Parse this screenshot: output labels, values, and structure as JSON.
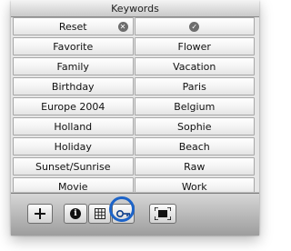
{
  "header": {
    "title": "Keywords"
  },
  "rows": [
    [
      "Reset",
      ""
    ],
    [
      "Favorite",
      "Flower"
    ],
    [
      "Family",
      "Vacation"
    ],
    [
      "Birthday",
      "Paris"
    ],
    [
      "Europe 2004",
      "Belgium"
    ],
    [
      "Holland",
      "Sophie"
    ],
    [
      "Holiday",
      "Beach"
    ],
    [
      "Sunset/Sunrise",
      "Raw"
    ],
    [
      "Movie",
      "Work"
    ]
  ],
  "icons": {
    "reset_clear": "x-circle-icon",
    "check": "checkmark-circle-icon",
    "add": "plus-icon",
    "info": "info-icon",
    "table": "grid-icon",
    "key": "key-icon",
    "fullscreen": "fullscreen-icon"
  },
  "accent": "#1c63c8"
}
